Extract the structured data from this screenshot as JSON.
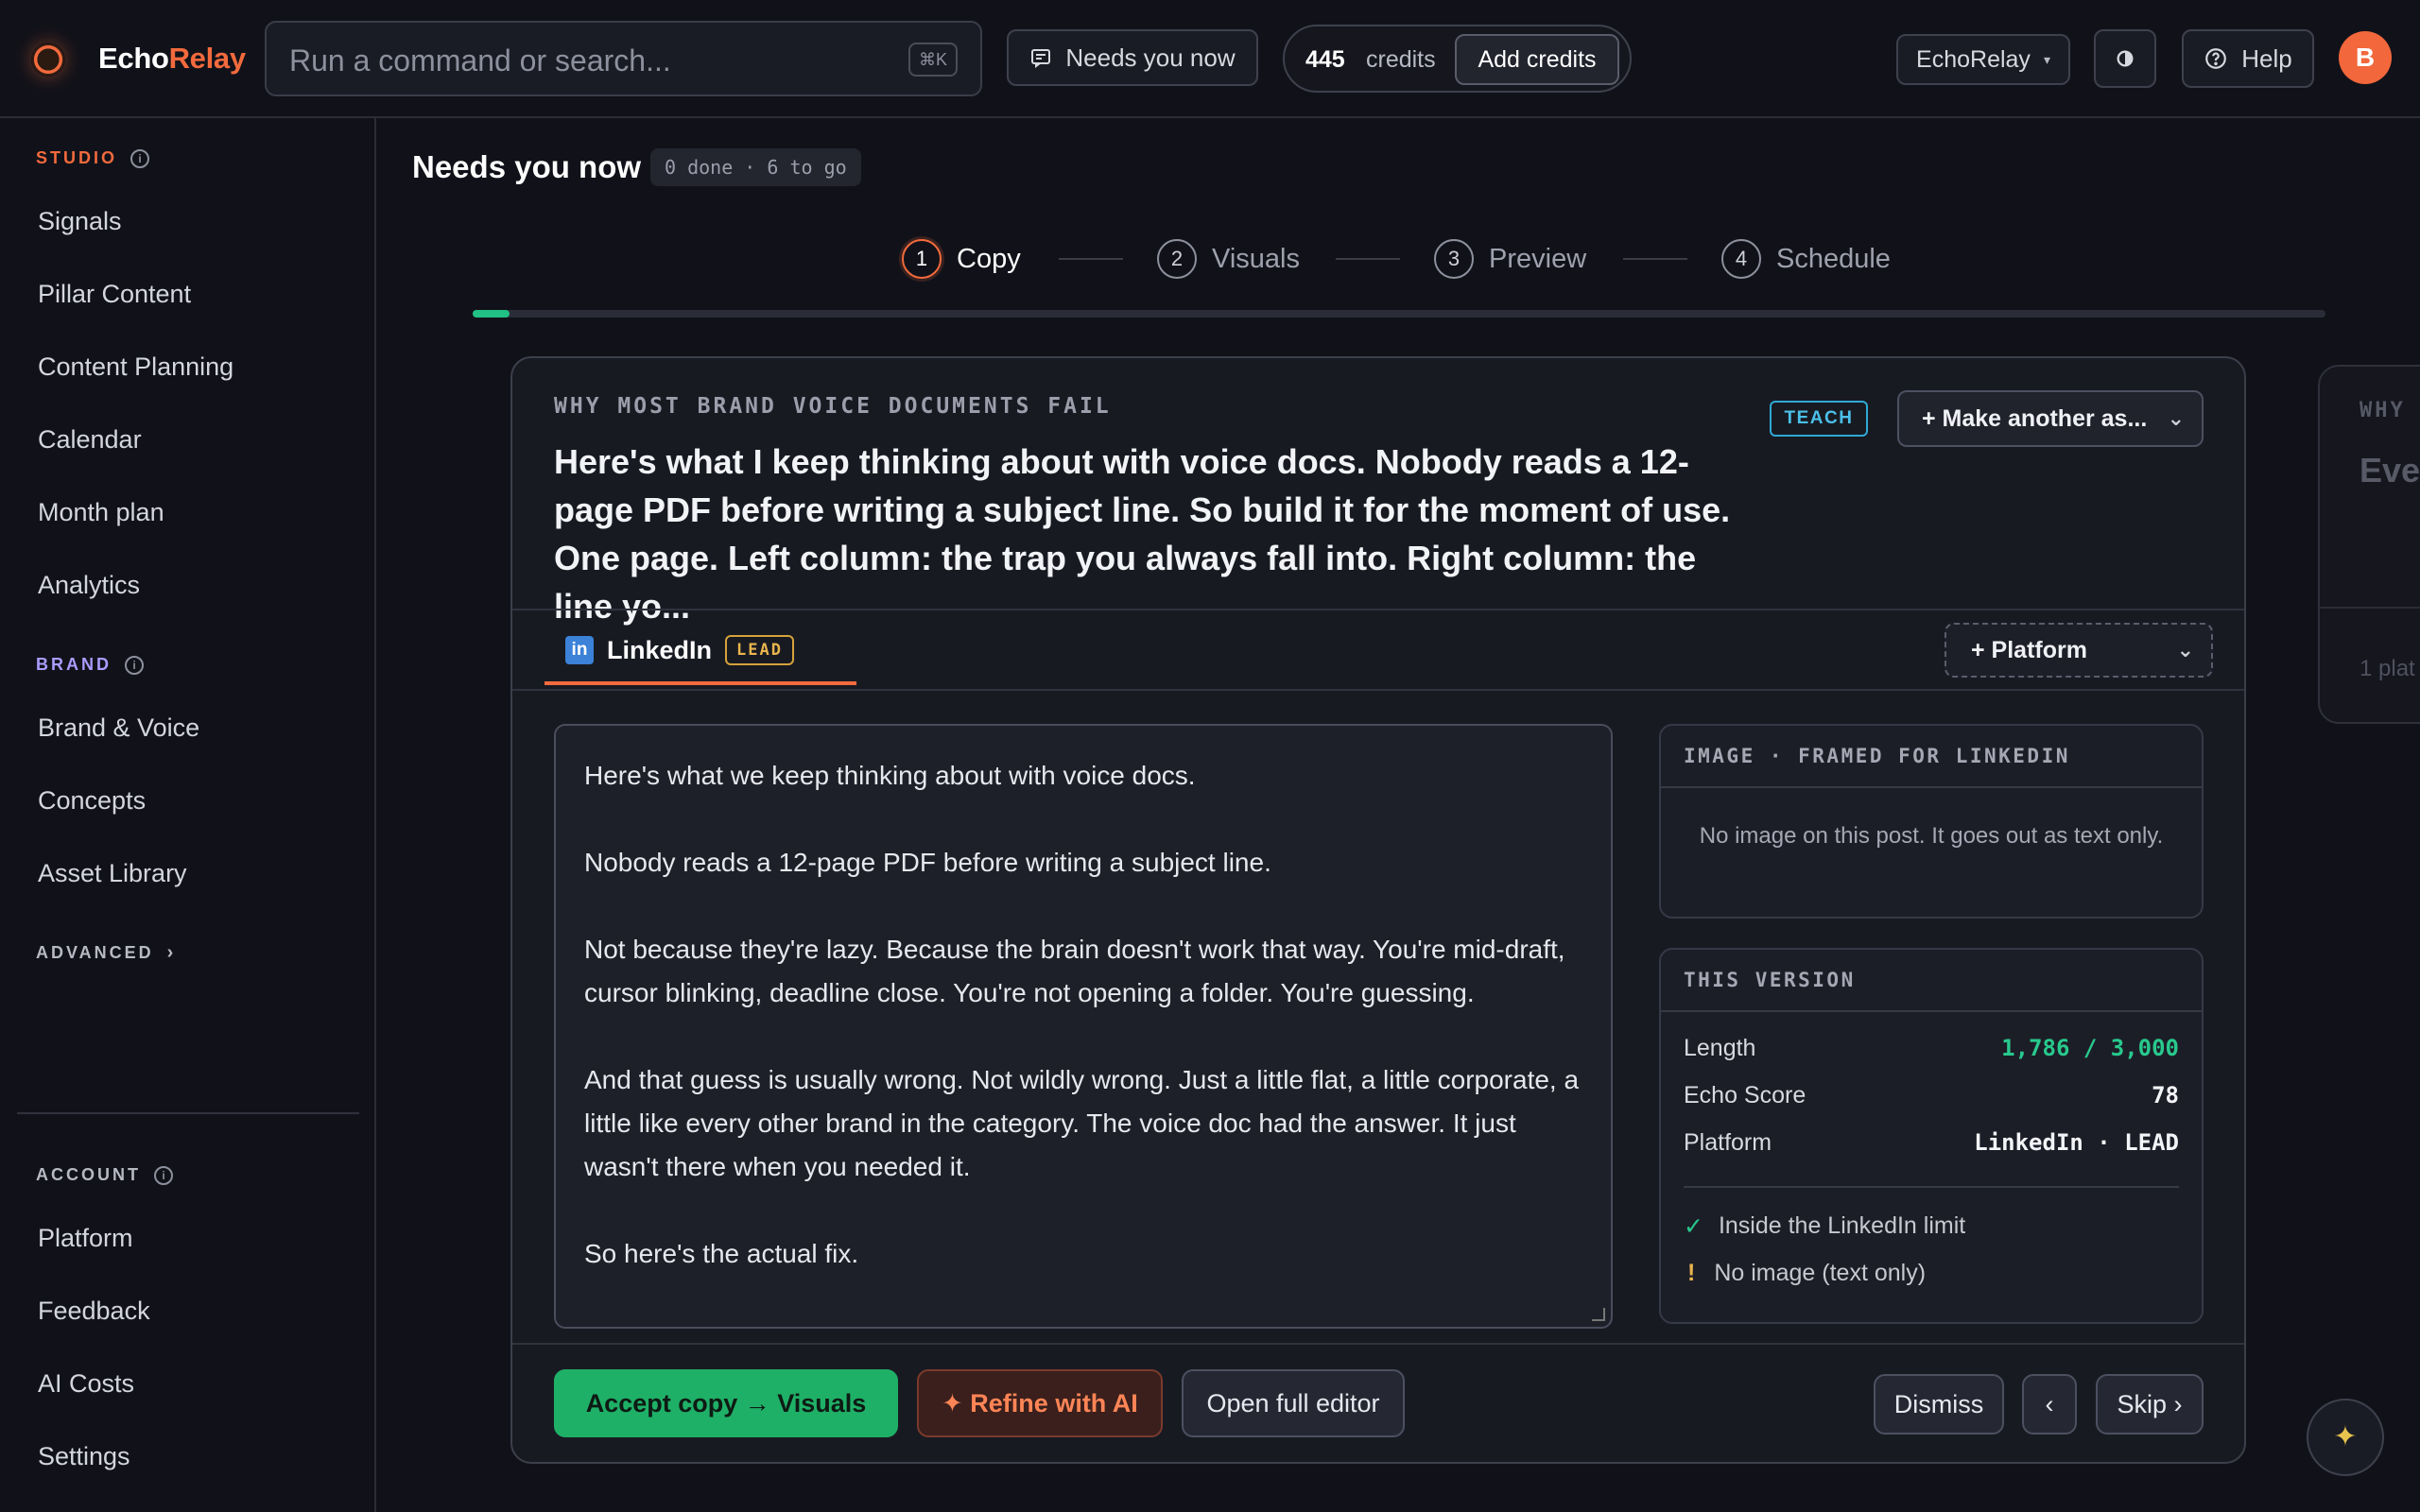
{
  "brand": {
    "name_part1": "Echo",
    "name_part2": "Relay"
  },
  "search": {
    "placeholder": "Run a command or search...",
    "shortcut": "⌘K"
  },
  "header": {
    "needs_label": "Needs you now",
    "credits_value": "445",
    "credits_label": "credits",
    "add_credits": "Add credits",
    "workspace": "EchoRelay",
    "help": "Help",
    "avatar_initial": "B"
  },
  "sidebar": {
    "studio_label": "STUDIO",
    "studio_items": [
      "Signals",
      "Pillar Content",
      "Content Planning",
      "Calendar",
      "Month plan",
      "Analytics"
    ],
    "brand_label": "BRAND",
    "brand_items": [
      "Brand & Voice",
      "Concepts",
      "Asset Library"
    ],
    "advanced_label": "ADVANCED",
    "account_label": "ACCOUNT",
    "account_items": [
      "Platform",
      "Feedback",
      "AI Costs",
      "Settings"
    ]
  },
  "page": {
    "title": "Needs you now",
    "progress": "0 done · 6 to go",
    "steps": [
      {
        "num": "1",
        "label": "Copy"
      },
      {
        "num": "2",
        "label": "Visuals"
      },
      {
        "num": "3",
        "label": "Preview"
      },
      {
        "num": "4",
        "label": "Schedule"
      }
    ],
    "progress_fraction": 0.02
  },
  "card": {
    "eyebrow": "WHY MOST BRAND VOICE DOCUMENTS FAIL",
    "headline": "Here's what I keep thinking about with voice docs. Nobody reads a 12-page PDF before writing a subject line. So build it for the moment of use. One page. Left column: the trap you always fall into. Right column: the line yo...",
    "tag": "TEACH",
    "make_another": "+ Make another as...",
    "platform_tab": "LinkedIn",
    "platform_icon": "in",
    "platform_badge": "LEAD",
    "add_platform": "+ Platform",
    "editor_paragraphs": [
      "Here's what we keep thinking about with voice docs.",
      "Nobody reads a 12-page PDF before writing a subject line.",
      "Not because they're lazy. Because the brain doesn't work that way. You're mid-draft, cursor blinking, deadline close. You're not opening a folder. You're guessing.",
      "And that guess is usually wrong. Not wildly wrong. Just a little flat, a little corporate, a little like every other brand in the category. The voice doc had the answer. It just wasn't there when you needed it.",
      "So here's the actual fix."
    ],
    "image_panel": {
      "title": "IMAGE · FRAMED FOR LINKEDIN",
      "message": "No image on this post. It goes out as text only."
    },
    "version_panel": {
      "title": "THIS VERSION",
      "length_label": "Length",
      "length_value": "1,786 / 3,000",
      "score_label": "Echo Score",
      "score_value": "78",
      "platform_label": "Platform",
      "platform_value": "LinkedIn · LEAD",
      "check_ok": "Inside the LinkedIn limit",
      "check_warn": "No image (text only)"
    },
    "actions": {
      "accept": "Accept copy → Visuals",
      "refine": "✦ Refine with AI",
      "full_editor": "Open full editor",
      "dismiss": "Dismiss",
      "prev": "‹",
      "skip": "Skip ›"
    }
  },
  "next_card": {
    "eyebrow": "WHY",
    "headline": "Ever capt char",
    "footer": "1 plat"
  },
  "colors": {
    "accent": "#f26a3d",
    "success": "#1fb067",
    "teach": "#4bc0ea",
    "lead": "#e8b54d"
  }
}
